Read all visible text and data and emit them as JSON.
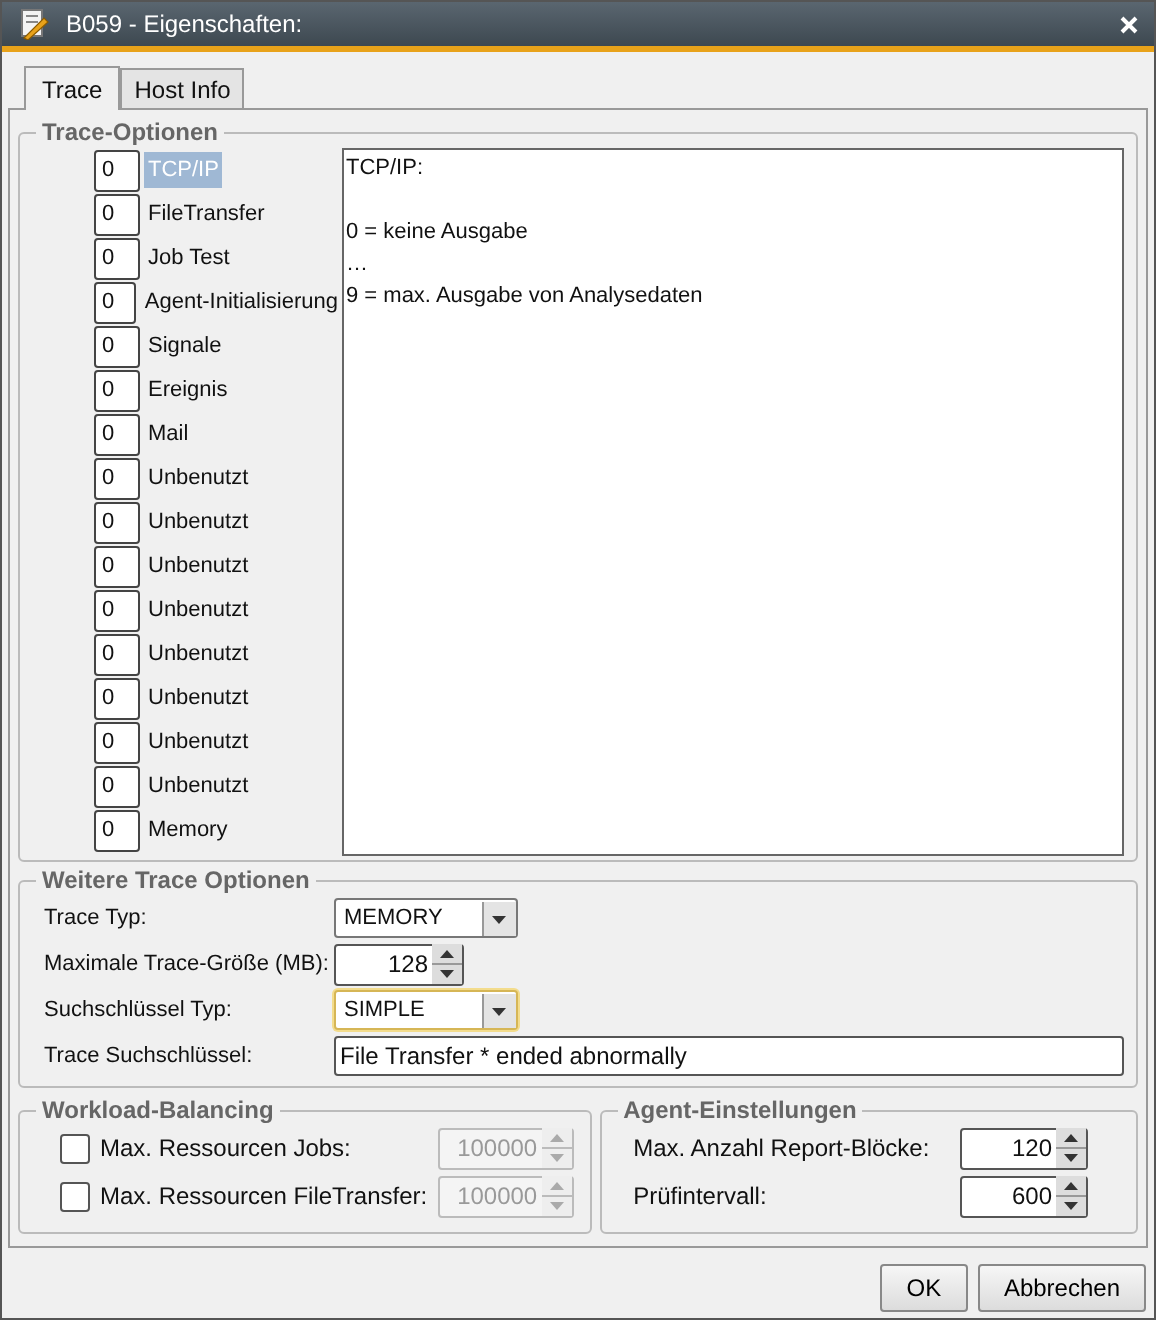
{
  "window": {
    "title": "B059 - Eigenschaften:"
  },
  "tabs": [
    {
      "label": "Trace",
      "selected": true
    },
    {
      "label": "Host Info",
      "selected": false
    }
  ],
  "trace_options": {
    "title": "Trace-Optionen",
    "levels": [
      {
        "value": "0",
        "label": "TCP/IP",
        "selected": true
      },
      {
        "value": "0",
        "label": "FileTransfer",
        "selected": false
      },
      {
        "value": "0",
        "label": "Job Test",
        "selected": false
      },
      {
        "value": "0",
        "label": "Agent-Initialisierung",
        "selected": false
      },
      {
        "value": "0",
        "label": "Signale",
        "selected": false
      },
      {
        "value": "0",
        "label": "Ereignis",
        "selected": false
      },
      {
        "value": "0",
        "label": "Mail",
        "selected": false
      },
      {
        "value": "0",
        "label": "Unbenutzt",
        "selected": false
      },
      {
        "value": "0",
        "label": "Unbenutzt",
        "selected": false
      },
      {
        "value": "0",
        "label": "Unbenutzt",
        "selected": false
      },
      {
        "value": "0",
        "label": "Unbenutzt",
        "selected": false
      },
      {
        "value": "0",
        "label": "Unbenutzt",
        "selected": false
      },
      {
        "value": "0",
        "label": "Unbenutzt",
        "selected": false
      },
      {
        "value": "0",
        "label": "Unbenutzt",
        "selected": false
      },
      {
        "value": "0",
        "label": "Unbenutzt",
        "selected": false
      },
      {
        "value": "0",
        "label": "Memory",
        "selected": false
      }
    ],
    "description": {
      "heading": "TCP/IP:",
      "lines": [
        "0 = keine Ausgabe",
        "…",
        "9 = max. Ausgabe von Analysedaten"
      ]
    }
  },
  "further_options": {
    "title": "Weitere Trace Optionen",
    "fields": [
      {
        "kind": "dropdown",
        "label": "Trace Typ:",
        "value": "MEMORY",
        "focused": false
      },
      {
        "kind": "spinner",
        "label": "Maximale Trace-Größe (MB):",
        "value": "128"
      },
      {
        "kind": "dropdown",
        "label": "Suchschlüssel Typ:",
        "value": "SIMPLE",
        "focused": true
      },
      {
        "kind": "text",
        "label": "Trace Suchschlüssel:",
        "value": "File Transfer * ended abnormally"
      }
    ]
  },
  "workload_balancing": {
    "title": "Workload-Balancing",
    "items": [
      {
        "label": "Max. Ressourcen Jobs:",
        "checked": false,
        "value": "100000",
        "disabled": true
      },
      {
        "label": "Max. Ressourcen FileTransfer:",
        "checked": false,
        "value": "100000",
        "disabled": true
      }
    ]
  },
  "agent_settings": {
    "title": "Agent-Einstellungen",
    "items": [
      {
        "label": "Max. Anzahl Report-Blöcke:",
        "value": "120"
      },
      {
        "label": "Prüfintervall:",
        "value": "600"
      }
    ]
  },
  "buttons": [
    {
      "label": "OK"
    },
    {
      "label": "Abbrechen"
    }
  ]
}
